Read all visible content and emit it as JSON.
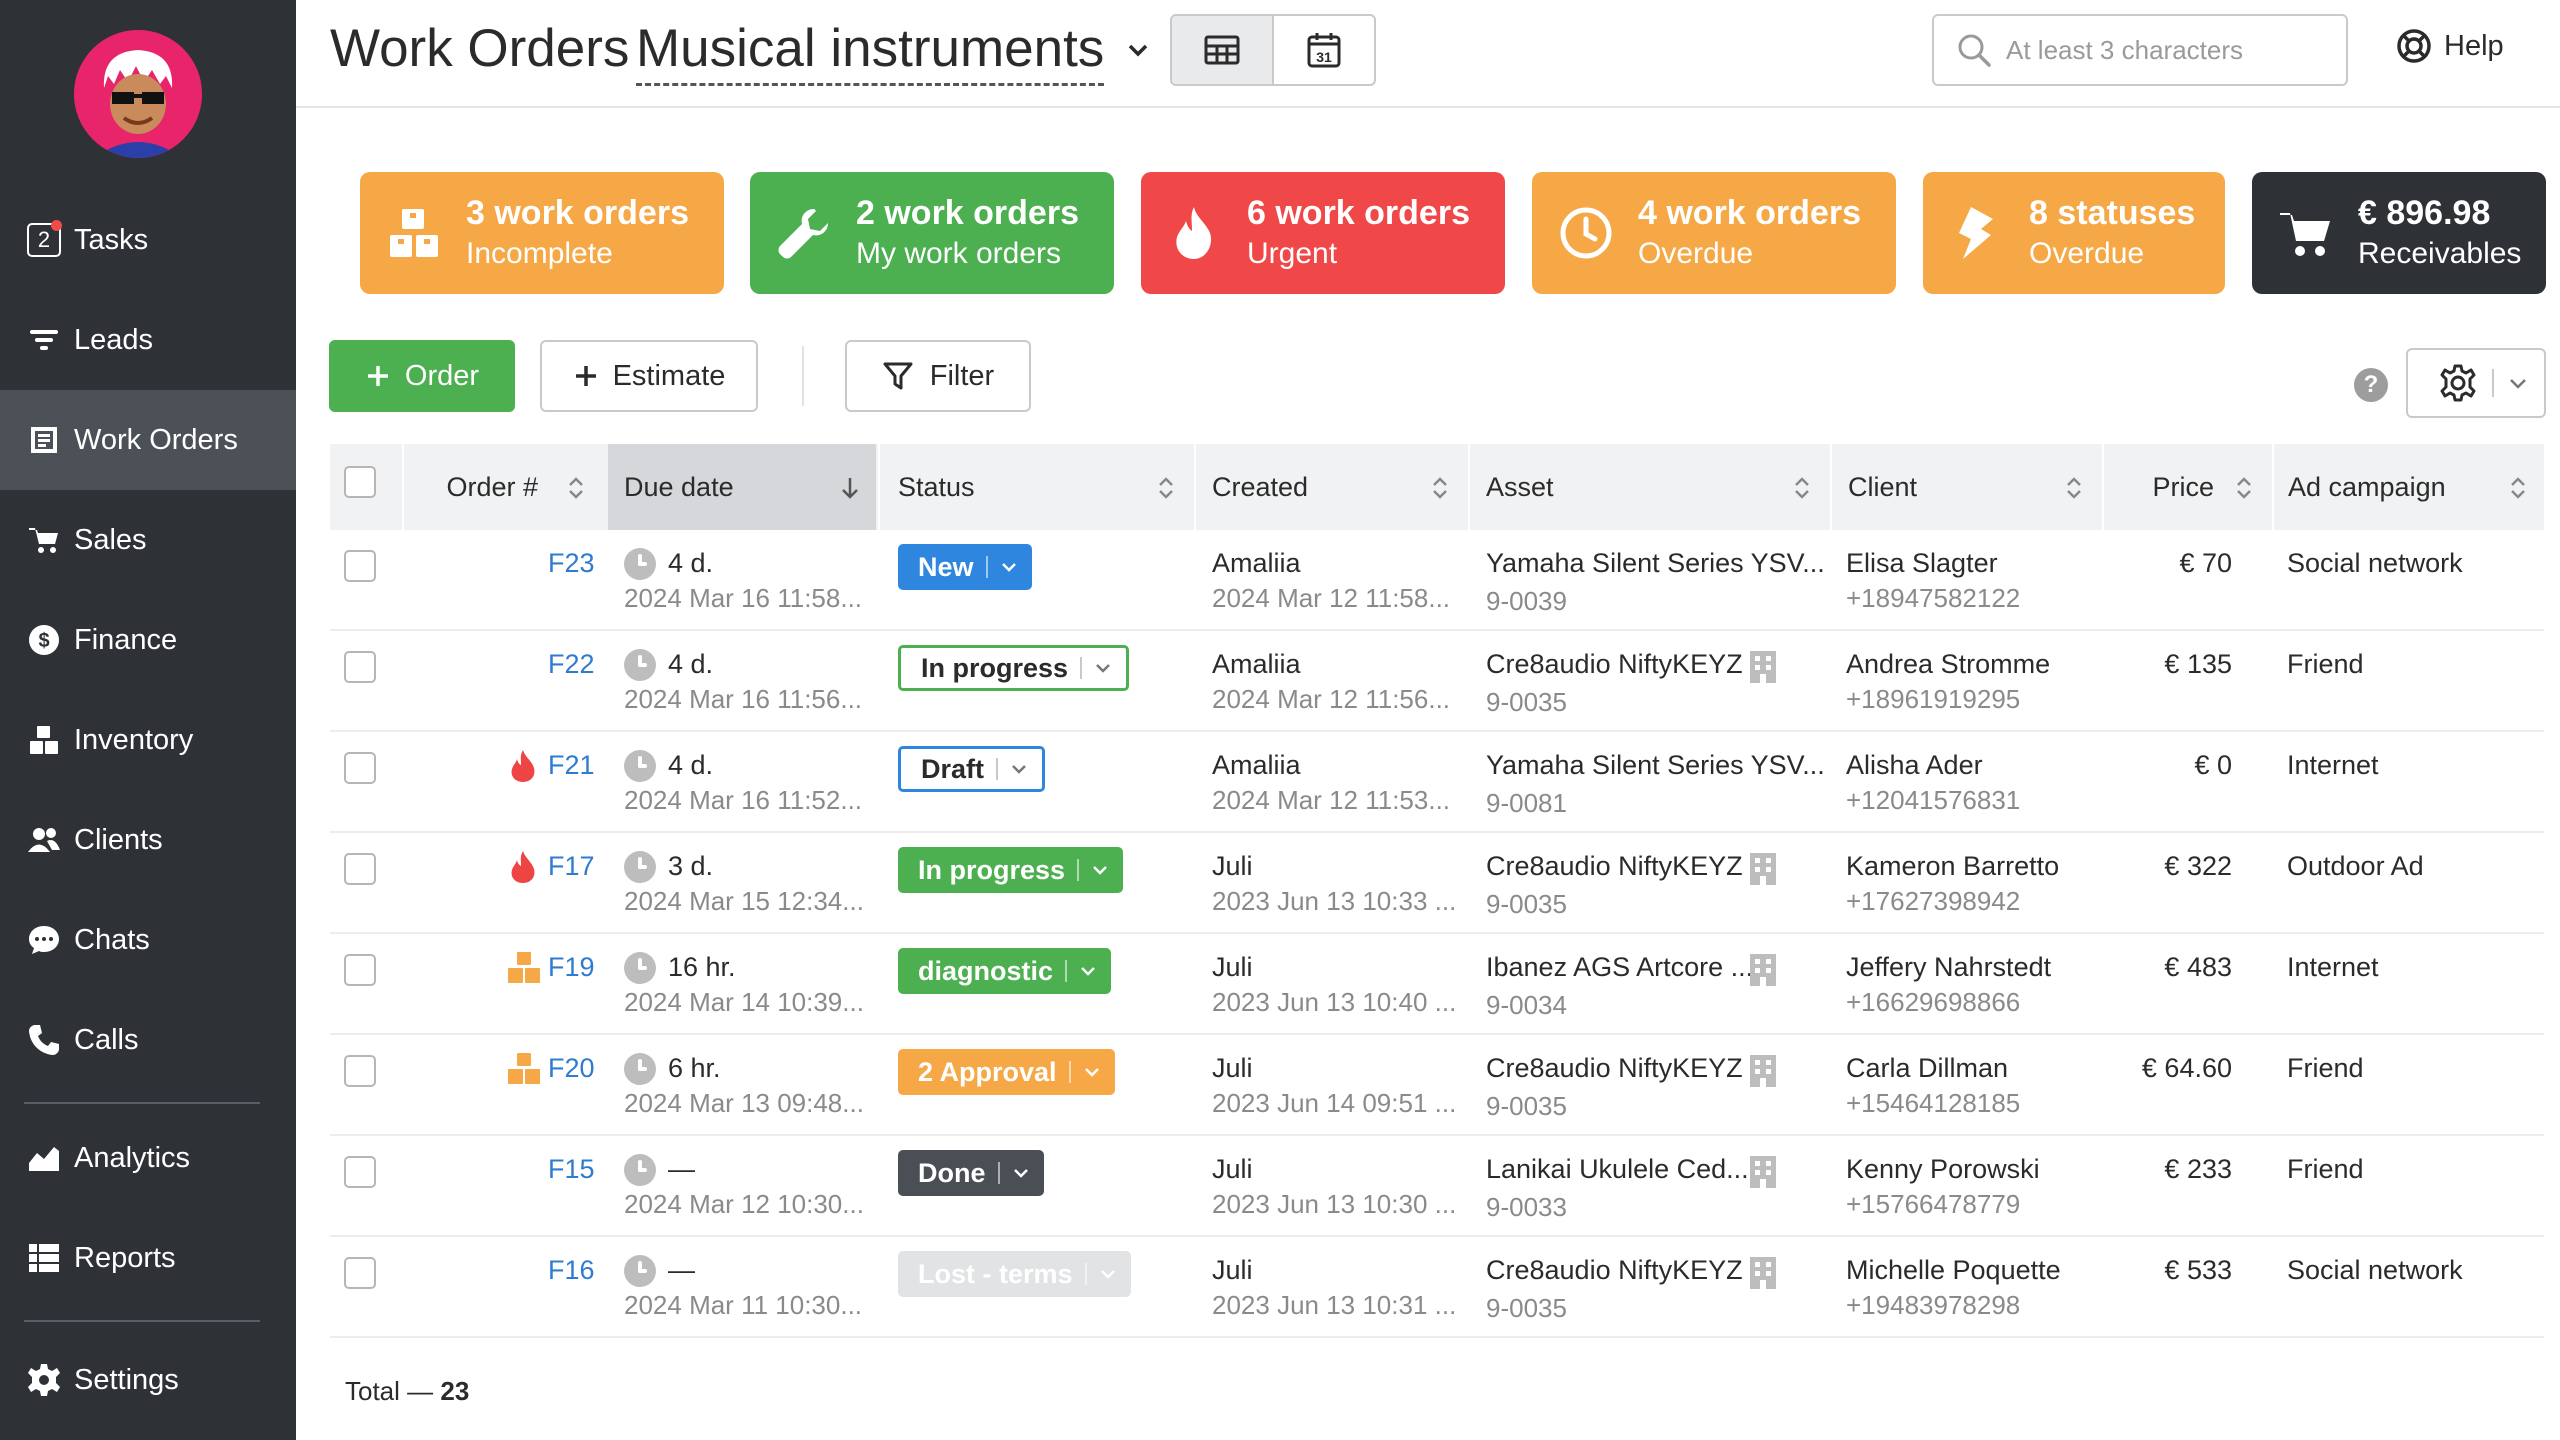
{
  "sidebar": {
    "tasks_count": "2",
    "items": [
      {
        "label": "Tasks",
        "icon": "tasks-icon"
      },
      {
        "label": "Leads",
        "icon": "filter-icon"
      },
      {
        "label": "Work Orders",
        "icon": "work-orders-icon"
      },
      {
        "label": "Sales",
        "icon": "cart-icon"
      },
      {
        "label": "Finance",
        "icon": "dollar-icon"
      },
      {
        "label": "Inventory",
        "icon": "boxes-icon"
      },
      {
        "label": "Clients",
        "icon": "users-icon"
      },
      {
        "label": "Chats",
        "icon": "chat-icon"
      },
      {
        "label": "Calls",
        "icon": "phone-icon"
      },
      {
        "label": "Analytics",
        "icon": "chart-icon"
      },
      {
        "label": "Reports",
        "icon": "reports-icon"
      },
      {
        "label": "Settings",
        "icon": "gear-icon"
      }
    ],
    "active": "Work Orders"
  },
  "header": {
    "title": "Work Orders",
    "location": "Musical instruments",
    "search_placeholder": "At least 3 characters",
    "help_label": "Help",
    "calendar_day": "31"
  },
  "cards": [
    {
      "title": "3 work orders",
      "subtitle": "Incomplete",
      "color": "#f5a845",
      "icon": "boxes-icon"
    },
    {
      "title": "2 work orders",
      "subtitle": "My work orders",
      "color": "#4caf50",
      "icon": "wrench-icon"
    },
    {
      "title": "6 work orders",
      "subtitle": "Urgent",
      "color": "#f04848",
      "icon": "fire-icon"
    },
    {
      "title": "4 work orders",
      "subtitle": "Overdue",
      "color": "#f5a845",
      "icon": "clock-icon"
    },
    {
      "title": "8 statuses",
      "subtitle": "Overdue",
      "color": "#f5a845",
      "icon": "lightning-icon"
    },
    {
      "title": "€ 896.98",
      "subtitle": "Receivables",
      "color": "#2e3237",
      "icon": "cart-icon"
    }
  ],
  "toolbar": {
    "order_label": "Order",
    "estimate_label": "Estimate",
    "filter_label": "Filter",
    "help_mark": "?"
  },
  "table": {
    "columns": [
      "Order #",
      "Due date",
      "Status",
      "Created",
      "Asset",
      "Client",
      "Price",
      "Ad campaign"
    ],
    "sorted_column": "Due date",
    "rows": [
      {
        "order": "F23",
        "flag": "",
        "due": "4 d.",
        "due_date": "2024 Mar 16 11:58...",
        "status": "New",
        "status_style": "blue",
        "created_by": "Amaliia",
        "created_at": "2024 Mar 12 11:58...",
        "asset": "Yamaha Silent Series YSV...",
        "asset_id": "9-0039",
        "asset_building": false,
        "client": "Elisa Slagter",
        "phone": "+18947582122",
        "price": "€ 70",
        "campaign": "Social network"
      },
      {
        "order": "F22",
        "flag": "",
        "due": "4 d.",
        "due_date": "2024 Mar 16 11:56...",
        "status": "In progress",
        "status_style": "green-outline",
        "created_by": "Amaliia",
        "created_at": "2024 Mar 12 11:56...",
        "asset": "Cre8audio NiftyKEYZ",
        "asset_id": "9-0035",
        "asset_building": true,
        "client": "Andrea Stromme",
        "phone": "+18961919295",
        "price": "€ 135",
        "campaign": "Friend"
      },
      {
        "order": "F21",
        "flag": "fire",
        "due": "4 d.",
        "due_date": "2024 Mar 16 11:52...",
        "status": "Draft",
        "status_style": "blue-outline",
        "created_by": "Amaliia",
        "created_at": "2024 Mar 12 11:53...",
        "asset": "Yamaha Silent Series YSV...",
        "asset_id": "9-0081",
        "asset_building": false,
        "client": "Alisha Ader",
        "phone": "+12041576831",
        "price": "€ 0",
        "campaign": "Internet"
      },
      {
        "order": "F17",
        "flag": "fire",
        "due": "3 d.",
        "due_date": "2024 Mar 15 12:34...",
        "status": "In progress",
        "status_style": "green",
        "created_by": "Juli",
        "created_at": "2023 Jun 13 10:33 ...",
        "asset": "Cre8audio NiftyKEYZ",
        "asset_id": "9-0035",
        "asset_building": true,
        "client": "Kameron Barretto",
        "phone": "+17627398942",
        "price": "€ 322",
        "campaign": "Outdoor Ad"
      },
      {
        "order": "F19",
        "flag": "boxes",
        "due": "16 hr.",
        "due_date": "2024 Mar 14 10:39...",
        "status": "diagnostic",
        "status_style": "green",
        "created_by": "Juli",
        "created_at": "2023 Jun 13 10:40 ...",
        "asset": "Ibanez AGS Artcore ...",
        "asset_id": "9-0034",
        "asset_building": true,
        "client": "Jeffery Nahrstedt",
        "phone": "+16629698866",
        "price": "€ 483",
        "campaign": "Internet"
      },
      {
        "order": "F20",
        "flag": "boxes",
        "due": "6 hr.",
        "due_date": "2024 Mar 13 09:48...",
        "status": "2 Approval",
        "status_style": "orange",
        "created_by": "Juli",
        "created_at": "2023 Jun 14 09:51 ...",
        "asset": "Cre8audio NiftyKEYZ",
        "asset_id": "9-0035",
        "asset_building": true,
        "client": "Carla Dillman",
        "phone": "+15464128185",
        "price": "€ 64.60",
        "campaign": "Friend"
      },
      {
        "order": "F15",
        "flag": "",
        "due": "—",
        "due_date": "2024 Mar 12 10:30...",
        "status": "Done",
        "status_style": "dark",
        "created_by": "Juli",
        "created_at": "2023 Jun 13 10:30 ...",
        "asset": "Lanikai Ukulele Ced...",
        "asset_id": "9-0033",
        "asset_building": true,
        "client": "Kenny Porowski",
        "phone": "+15766478779",
        "price": "€ 233",
        "campaign": "Friend"
      },
      {
        "order": "F16",
        "flag": "",
        "due": "—",
        "due_date": "2024 Mar 11 10:30...",
        "status": "Lost - terms",
        "status_style": "gray",
        "created_by": "Juli",
        "created_at": "2023 Jun 13 10:31 ...",
        "asset": "Cre8audio NiftyKEYZ",
        "asset_id": "9-0035",
        "asset_building": true,
        "client": "Michelle Poquette",
        "phone": "+19483978298",
        "price": "€ 533",
        "campaign": "Social network"
      }
    ],
    "total_label": "Total —",
    "total_value": "23"
  }
}
